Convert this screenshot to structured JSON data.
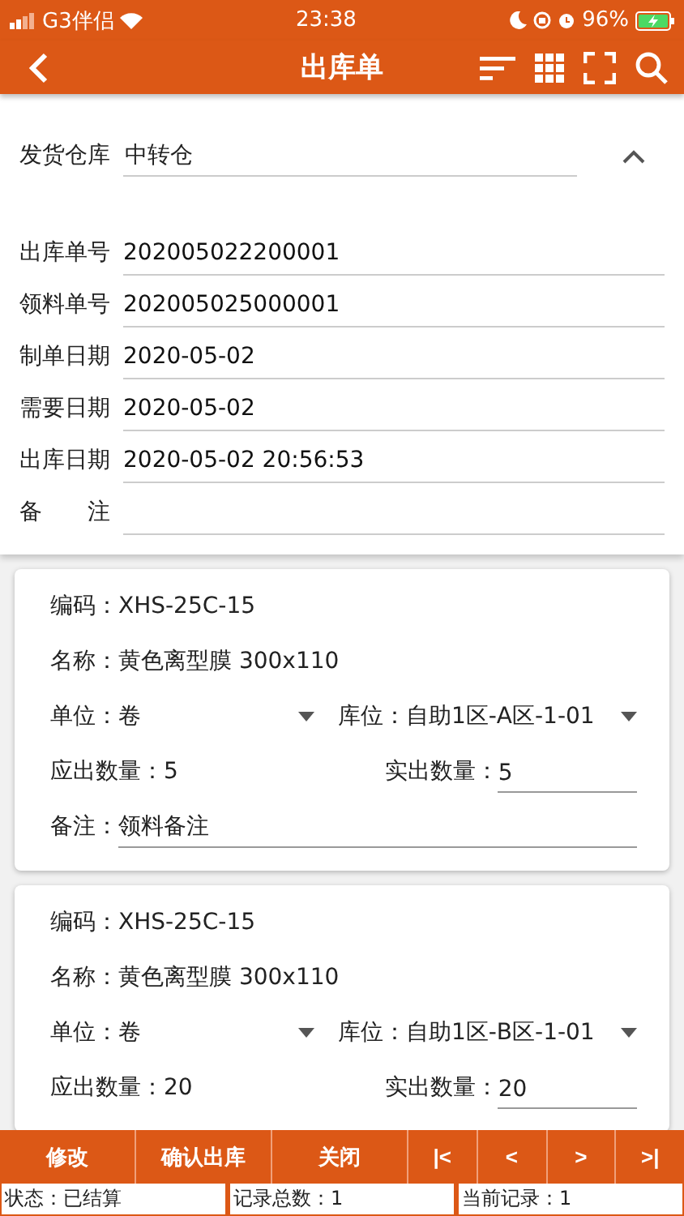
{
  "status_bar": {
    "carrier": "G3伴侣",
    "time": "23:38",
    "battery": "96%"
  },
  "header": {
    "title": "出库单"
  },
  "warehouse": {
    "label": "发货仓库",
    "value": "中转仓",
    "expanded": true
  },
  "fields": [
    {
      "label": "出库单号",
      "value": "202005022200001"
    },
    {
      "label": "领料单号",
      "value": "202005025000001"
    },
    {
      "label": "制单日期",
      "value": "2020-05-02"
    },
    {
      "label": "需要日期",
      "value": "2020-05-02"
    },
    {
      "label": "出库日期",
      "value": "2020-05-02 20:56:53"
    },
    {
      "label": "备　　注"
    }
  ],
  "items": [
    {
      "code_label": "编码：",
      "code": "XHS-25C-15",
      "name_label": "名称：",
      "name": "黄色离型膜 300x110",
      "unit_label": "单位：",
      "unit": "卷",
      "location_label": "库位：",
      "location": "自助1区-A区-1-01",
      "due_label": "应出数量：",
      "due": "5",
      "actual_label": "实出数量：",
      "actual": "5",
      "note_label": "备注：",
      "note": "领料备注"
    },
    {
      "code_label": "编码：",
      "code": "XHS-25C-15",
      "name_label": "名称：",
      "name": "黄色离型膜 300x110",
      "unit_label": "单位：",
      "unit": "卷",
      "location_label": "库位：",
      "location": "自助1区-B区-1-01",
      "due_label": "应出数量：",
      "due": "20",
      "actual_label": "实出数量：",
      "actual": "20"
    }
  ],
  "toolbar": [
    {
      "kind": "text",
      "label": "修改"
    },
    {
      "kind": "text",
      "label": "确认出库"
    },
    {
      "kind": "text",
      "label": "关闭"
    },
    {
      "kind": "first",
      "label": "|<"
    },
    {
      "kind": "prev",
      "label": "<"
    },
    {
      "kind": "next",
      "label": ">"
    },
    {
      "kind": "last",
      "label": ">|"
    }
  ],
  "footer": [
    "状态：已结算",
    "记录总数：1",
    "当前记录：1"
  ]
}
